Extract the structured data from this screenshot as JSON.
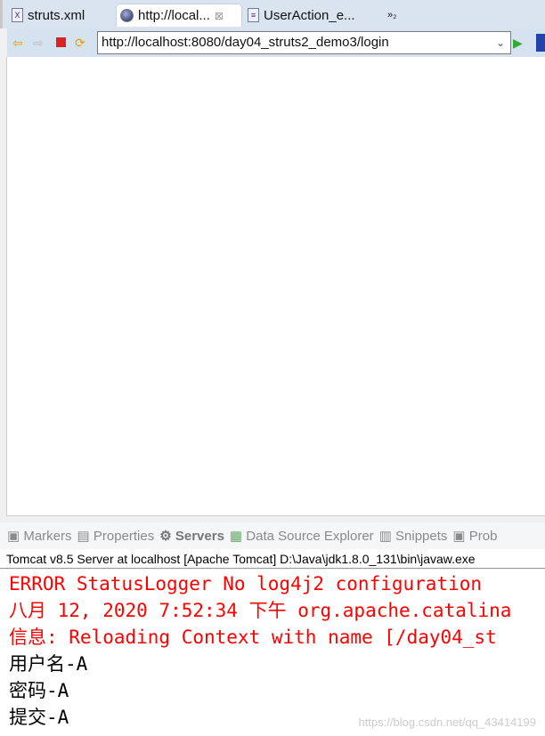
{
  "tabs": [
    {
      "label": "struts.xml"
    },
    {
      "label": "http://local..."
    },
    {
      "label": "UserAction_e..."
    }
  ],
  "tabs_overflow": "»₂",
  "address": {
    "url": "http://localhost:8080/day04_struts2_demo3/login"
  },
  "views": [
    {
      "label": "Markers"
    },
    {
      "label": "Properties"
    },
    {
      "label": "Servers"
    },
    {
      "label": "Data Source Explorer"
    },
    {
      "label": "Snippets"
    },
    {
      "label": "Prob"
    }
  ],
  "console": {
    "header": "Tomcat v8.5 Server at localhost [Apache Tomcat] D:\\Java\\jdk1.8.0_131\\bin\\javaw.exe",
    "lines": [
      {
        "text": "ERROR StatusLogger No log4j2 configuration",
        "color": "#ff0000"
      },
      {
        "text": "八月 12, 2020 7:52:34 下午 org.apache.catalina",
        "color": "#ff0000"
      },
      {
        "text": "信息: Reloading Context with name [/day04_st",
        "color": "#ff0000"
      },
      {
        "text": "用户名-A",
        "color": "#000000"
      },
      {
        "text": "密码-A",
        "color": "#000000"
      },
      {
        "text": "提交-A",
        "color": "#000000"
      }
    ]
  },
  "watermark": "https://blog.csdn.net/qq_43414199"
}
